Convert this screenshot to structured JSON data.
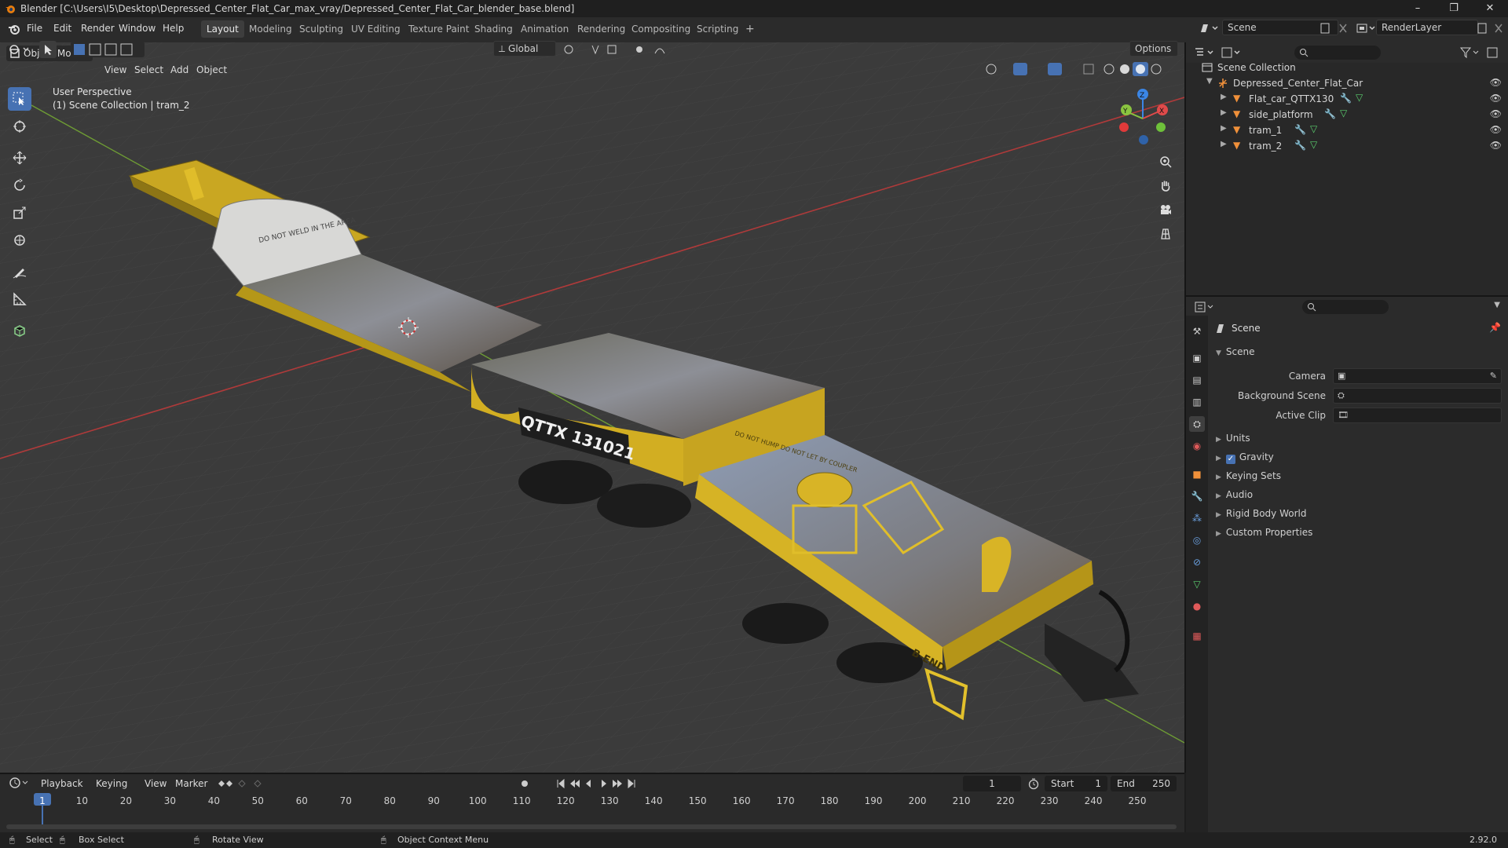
{
  "window": {
    "title": "Blender [C:\\Users\\I5\\Desktop\\Depressed_Center_Flat_Car_max_vray/Depressed_Center_Flat_Car_blender_base.blend]",
    "controls": [
      "–",
      "❐",
      "✕"
    ]
  },
  "menubar": {
    "items": [
      "File",
      "Edit",
      "Render",
      "Window",
      "Help"
    ],
    "workspaces": [
      "Layout",
      "Modeling",
      "Sculpting",
      "UV Editing",
      "Texture Paint",
      "Shading",
      "Animation",
      "Rendering",
      "Compositing",
      "Scripting"
    ],
    "active_workspace": "Layout",
    "add_tab": "+",
    "scene_name": "Scene",
    "view_layer": "RenderLayer"
  },
  "viewport": {
    "mode": "Object Mode",
    "menus": [
      "View",
      "Select",
      "Add",
      "Object"
    ],
    "transform_orientation": "Global",
    "options_label": "Options",
    "perspective_label": "User Perspective",
    "collection_label": "(1) Scene Collection | tram_2",
    "gizmo": {
      "x": "X",
      "y": "Y",
      "z": "Z"
    },
    "car_text": {
      "number": "QTTX 131021",
      "warning": "DO NOT WELD IN THE AREA",
      "end_mark": "B-END",
      "side_note": "DO NOT HUMP DO NOT LET BY COUPLER"
    }
  },
  "outliner": {
    "root": "Scene Collection",
    "collection": "Depressed_Center_Flat_Car",
    "objects": [
      "Flat_car_QTTX130",
      "side_platform",
      "tram_1",
      "tram_2"
    ]
  },
  "properties": {
    "header": "Scene",
    "section": "Scene",
    "fields": [
      {
        "label": "Camera",
        "value": ""
      },
      {
        "label": "Background Scene",
        "value": ""
      },
      {
        "label": "Active Clip",
        "value": ""
      }
    ],
    "panels": [
      "Units",
      "Gravity",
      "Keying Sets",
      "Audio",
      "Rigid Body World",
      "Custom Properties"
    ],
    "gravity_checked": true
  },
  "timeline": {
    "menus": [
      "Playback",
      "Keying",
      "View",
      "Marker"
    ],
    "current_frame": "1",
    "start_label": "Start",
    "start": "1",
    "end_label": "End",
    "end": "250",
    "ticks": [
      "1",
      "10",
      "20",
      "30",
      "40",
      "50",
      "60",
      "70",
      "80",
      "90",
      "100",
      "110",
      "120",
      "130",
      "140",
      "150",
      "160",
      "170",
      "180",
      "190",
      "200",
      "210",
      "220",
      "230",
      "240",
      "250"
    ]
  },
  "statusbar": {
    "select": "Select",
    "box_select": "Box Select",
    "rotate_view": "Rotate View",
    "context_menu": "Object Context Menu",
    "version": "2.92.0"
  },
  "colors": {
    "accent": "#4772b3",
    "car_yellow": "#d9b521",
    "axis_x": "#e04a4a",
    "axis_y": "#8ac440",
    "axis_z": "#3b86e6"
  }
}
